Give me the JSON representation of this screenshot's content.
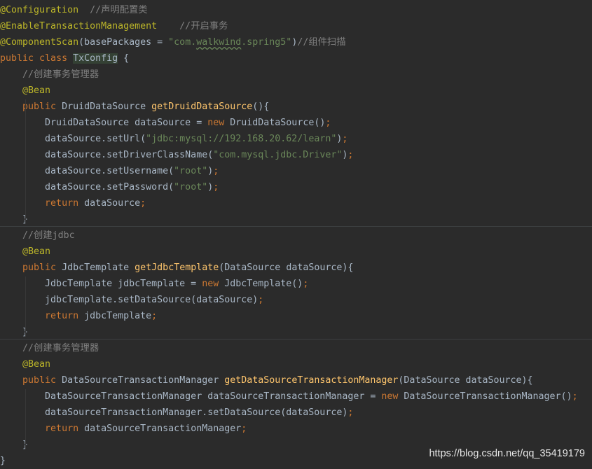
{
  "code_lines": [
    {
      "indent": "",
      "tokens": [
        {
          "t": "@Configuration",
          "c": "annotation"
        },
        {
          "t": "  //声明配置类",
          "c": "comment"
        }
      ]
    },
    {
      "indent": "",
      "tokens": [
        {
          "t": "@EnableTransactionManagement",
          "c": "annotation"
        },
        {
          "t": "    //开启事务",
          "c": "comment"
        }
      ]
    },
    {
      "indent": "",
      "tokens": [
        {
          "t": "@ComponentScan",
          "c": "annotation"
        },
        {
          "t": "(basePackages = ",
          "c": "plain"
        },
        {
          "t": "\"com.",
          "c": "string"
        },
        {
          "t": "walkwind",
          "c": "string typo"
        },
        {
          "t": ".spring5\"",
          "c": "string"
        },
        {
          "t": ")",
          "c": "plain"
        },
        {
          "t": "//组件扫描",
          "c": "comment"
        }
      ]
    },
    {
      "indent": "",
      "tokens": [
        {
          "t": "public ",
          "c": "keyword"
        },
        {
          "t": "class ",
          "c": "keyword"
        },
        {
          "t": "TxConfig",
          "c": "plain highlight"
        },
        {
          "t": " {",
          "c": "plain"
        }
      ]
    },
    {
      "indent": "    ",
      "tokens": [
        {
          "t": "//创建事务管理器",
          "c": "comment"
        }
      ]
    },
    {
      "indent": "    ",
      "tokens": [
        {
          "t": "@Bean",
          "c": "annotation"
        }
      ]
    },
    {
      "indent": "    ",
      "tokens": [
        {
          "t": "public ",
          "c": "keyword"
        },
        {
          "t": "DruidDataSource ",
          "c": "plain"
        },
        {
          "t": "getDruidDataSource",
          "c": "method"
        },
        {
          "t": "(){",
          "c": "plain"
        }
      ]
    },
    {
      "indent": "        ",
      "tokens": [
        {
          "t": "DruidDataSource dataSource = ",
          "c": "plain"
        },
        {
          "t": "new ",
          "c": "keyword"
        },
        {
          "t": "DruidDataSource()",
          "c": "plain"
        },
        {
          "t": ";",
          "c": "keyword"
        }
      ]
    },
    {
      "indent": "        ",
      "tokens": [
        {
          "t": "dataSource.setUrl(",
          "c": "plain"
        },
        {
          "t": "\"jdbc:mysql://192.168.20.62/learn\"",
          "c": "string"
        },
        {
          "t": ")",
          "c": "plain"
        },
        {
          "t": ";",
          "c": "keyword"
        }
      ]
    },
    {
      "indent": "        ",
      "tokens": [
        {
          "t": "dataSource.setDriverClassName(",
          "c": "plain"
        },
        {
          "t": "\"com.mysql.jdbc.Driver\"",
          "c": "string"
        },
        {
          "t": ")",
          "c": "plain"
        },
        {
          "t": ";",
          "c": "keyword"
        }
      ]
    },
    {
      "indent": "        ",
      "tokens": [
        {
          "t": "dataSource.setUsername(",
          "c": "plain"
        },
        {
          "t": "\"root\"",
          "c": "string"
        },
        {
          "t": ")",
          "c": "plain"
        },
        {
          "t": ";",
          "c": "keyword"
        }
      ]
    },
    {
      "indent": "        ",
      "tokens": [
        {
          "t": "dataSource.setPassword(",
          "c": "plain"
        },
        {
          "t": "\"root\"",
          "c": "string"
        },
        {
          "t": ")",
          "c": "plain"
        },
        {
          "t": ";",
          "c": "keyword"
        }
      ]
    },
    {
      "indent": "        ",
      "tokens": [
        {
          "t": "return ",
          "c": "keyword"
        },
        {
          "t": "dataSource",
          "c": "plain"
        },
        {
          "t": ";",
          "c": "keyword"
        }
      ]
    },
    {
      "indent": "    ",
      "tokens": [
        {
          "t": "}",
          "c": "plain"
        }
      ]
    },
    {
      "indent": "    ",
      "tokens": [
        {
          "t": "//创建jdbc",
          "c": "comment"
        }
      ]
    },
    {
      "indent": "    ",
      "tokens": [
        {
          "t": "@Bean",
          "c": "annotation"
        }
      ]
    },
    {
      "indent": "    ",
      "tokens": [
        {
          "t": "public ",
          "c": "keyword"
        },
        {
          "t": "JdbcTemplate ",
          "c": "plain"
        },
        {
          "t": "getJdbcTemplate",
          "c": "method"
        },
        {
          "t": "(DataSource dataSource){",
          "c": "plain"
        }
      ]
    },
    {
      "indent": "        ",
      "tokens": [
        {
          "t": "JdbcTemplate jdbcTemplate = ",
          "c": "plain"
        },
        {
          "t": "new ",
          "c": "keyword"
        },
        {
          "t": "JdbcTemplate()",
          "c": "plain"
        },
        {
          "t": ";",
          "c": "keyword"
        }
      ]
    },
    {
      "indent": "        ",
      "tokens": [
        {
          "t": "jdbcTemplate.setDataSource(dataSource)",
          "c": "plain"
        },
        {
          "t": ";",
          "c": "keyword"
        }
      ]
    },
    {
      "indent": "        ",
      "tokens": [
        {
          "t": "return ",
          "c": "keyword"
        },
        {
          "t": "jdbcTemplate",
          "c": "plain"
        },
        {
          "t": ";",
          "c": "keyword"
        }
      ]
    },
    {
      "indent": "    ",
      "tokens": [
        {
          "t": "}",
          "c": "plain"
        }
      ]
    },
    {
      "indent": "    ",
      "tokens": [
        {
          "t": "//创建事务管理器",
          "c": "comment"
        }
      ]
    },
    {
      "indent": "    ",
      "tokens": [
        {
          "t": "@Bean",
          "c": "annotation"
        }
      ]
    },
    {
      "indent": "    ",
      "tokens": [
        {
          "t": "public ",
          "c": "keyword"
        },
        {
          "t": "DataSourceTransactionManager ",
          "c": "plain"
        },
        {
          "t": "getDataSourceTransactionManager",
          "c": "method"
        },
        {
          "t": "(DataSource dataSource){",
          "c": "plain"
        }
      ]
    },
    {
      "indent": "        ",
      "tokens": [
        {
          "t": "DataSourceTransactionManager dataSourceTransactionManager = ",
          "c": "plain"
        },
        {
          "t": "new ",
          "c": "keyword"
        },
        {
          "t": "DataSourceTransactionManager()",
          "c": "plain"
        },
        {
          "t": ";",
          "c": "keyword"
        }
      ]
    },
    {
      "indent": "        ",
      "tokens": [
        {
          "t": "dataSourceTransactionManager.setDataSource(dataSource)",
          "c": "plain"
        },
        {
          "t": ";",
          "c": "keyword"
        }
      ]
    },
    {
      "indent": "        ",
      "tokens": [
        {
          "t": "return ",
          "c": "keyword"
        },
        {
          "t": "dataSourceTransactionManager",
          "c": "plain"
        },
        {
          "t": ";",
          "c": "keyword"
        }
      ]
    },
    {
      "indent": "    ",
      "tokens": [
        {
          "t": "}",
          "c": "plain"
        }
      ]
    },
    {
      "indent": "",
      "tokens": [
        {
          "t": "}",
          "c": "plain"
        }
      ]
    }
  ],
  "watermark": "https://blog.csdn.net/qq_35419179",
  "colors": {
    "background": "#2b2b2b",
    "annotation": "#bbb529",
    "comment": "#808080",
    "keyword": "#cc7832",
    "string": "#6a8759",
    "method": "#ffc66d",
    "plain": "#a9b7c6"
  }
}
